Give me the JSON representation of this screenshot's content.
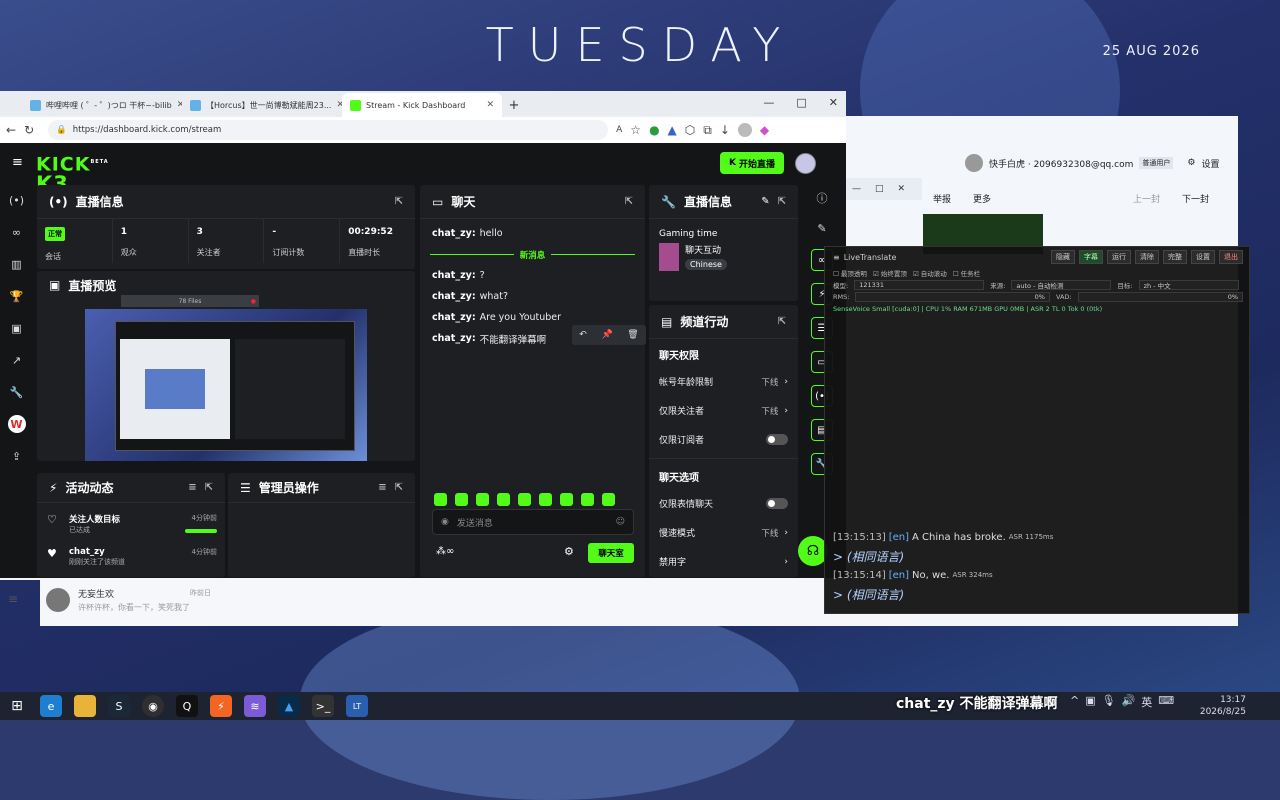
{
  "wallpaper": {
    "title": "TUESDAY",
    "date": "25 AUG 2026"
  },
  "browser": {
    "tabs": [
      {
        "label": "哔哩哔哩 ( ゜- ゜)つロ 干杯~-bilib",
        "icon_color": "#5fb3e6",
        "active": false
      },
      {
        "label": "【Horcus】世一尚博勒斌能周23...",
        "icon_color": "#5fb3e6",
        "active": false
      },
      {
        "label": "Stream - Kick Dashboard",
        "icon_color": "#53fc18",
        "active": true
      }
    ],
    "new_tab": "+",
    "url": "https://dashboard.kick.com/stream"
  },
  "kick": {
    "logo": "KICK",
    "logo_beta": "BETA",
    "go_live_label": "开始直播",
    "stream_info": {
      "title": "直播信息",
      "stats": [
        {
          "value": "正常",
          "label": "会话",
          "badge": true
        },
        {
          "value": "1",
          "label": "观众"
        },
        {
          "value": "3",
          "label": "关注者"
        },
        {
          "value": "-",
          "label": "订阅计数"
        },
        {
          "value": "00:29:52",
          "label": "直播时长"
        }
      ]
    },
    "preview": {
      "title": "直播预览",
      "file_chip": "78 Files"
    },
    "activity": {
      "title": "活动动态",
      "items": [
        {
          "title": "关注人数目标",
          "sub": "已达成",
          "time": "4分钟前"
        },
        {
          "title": "chat_zy",
          "sub": "刚刚关注了该频道",
          "time": "4分钟前"
        }
      ]
    },
    "mod_actions": {
      "title": "管理员操作"
    },
    "chat": {
      "title": "聊天",
      "messages": [
        {
          "user": "chat_zy:",
          "text": "hello"
        },
        {
          "user": "chat_zy:",
          "text": "?"
        },
        {
          "user": "chat_zy:",
          "text": "what?"
        },
        {
          "user": "chat_zy:",
          "text": "Are you Youtuber"
        },
        {
          "user": "chat_zy:",
          "text": "不能翻译弹幕啊"
        }
      ],
      "new_messages_label": "新消息",
      "input_placeholder": "发送消息",
      "chat_room_button": "聊天室"
    },
    "stream_info_right": {
      "title": "直播信息",
      "category_label": "Gaming time",
      "category_name": "聊天互动",
      "language_tag": "Chinese"
    },
    "channel_actions": {
      "title": "频道行动",
      "sections": [
        {
          "name": "聊天权限",
          "rows": [
            {
              "label": "帐号年龄限制",
              "value": "下线",
              "type": "chevron"
            },
            {
              "label": "仅限关注者",
              "value": "下线",
              "type": "chevron"
            },
            {
              "label": "仅限订阅者",
              "value": "",
              "type": "toggle"
            }
          ]
        },
        {
          "name": "聊天选项",
          "rows": [
            {
              "label": "仅限表情聊天",
              "value": "",
              "type": "toggle"
            },
            {
              "label": "慢速模式",
              "value": "下线",
              "type": "chevron"
            },
            {
              "label": "禁用字",
              "value": "",
              "type": "chevron"
            }
          ]
        }
      ]
    }
  },
  "qq": {
    "user": "快手白虎 · 2096932308@qq.com",
    "user_badge": "普通用户",
    "settings": "设置",
    "toolbar": [
      "举报",
      "更多",
      "上一封",
      "下一封"
    ]
  },
  "mail_row": {
    "name": "无妄生欢",
    "time": "昨前日",
    "preview": "许杯许杯，你看一下，笑死我了"
  },
  "livetranslate": {
    "title": "LiveTranslate",
    "buttons": [
      "隐藏",
      "字幕",
      "运行",
      "清除",
      "完整",
      "设置",
      "退出"
    ],
    "checks": [
      "最顶透明",
      "始终置顶",
      "自动滚动",
      "任务栏"
    ],
    "fields": {
      "model_label": "模型:",
      "model": "121331",
      "source_label": "来源:",
      "source": "auto - 自动检测",
      "target_label": "目标:",
      "target": "zh - 中文"
    },
    "rms": "RMS:",
    "rms_val": "0%",
    "vad": "VAD:",
    "vad_val": "0%",
    "status": "SenseVoice Small [cuda:0]  |  CPU 1% RAM 671MB GPU 0MB | ASR 2 TL 0 Tok 0 (0tk)",
    "lines": [
      {
        "ts": "[13:15:13]",
        "lang": "[en]",
        "text": "A China has broke.",
        "asr": "ASR 1175ms",
        "tr": "> (相同语言)"
      },
      {
        "ts": "[13:15:14]",
        "lang": "[en]",
        "text": "No, we.",
        "asr": "ASR 324ms",
        "tr": "> (相同语言)"
      }
    ]
  },
  "taskbar": {
    "overlay_subtitle": "chat_zy  不能翻译弹幕啊",
    "ime": "英",
    "time": "13:17",
    "date": "2026/8/25"
  }
}
